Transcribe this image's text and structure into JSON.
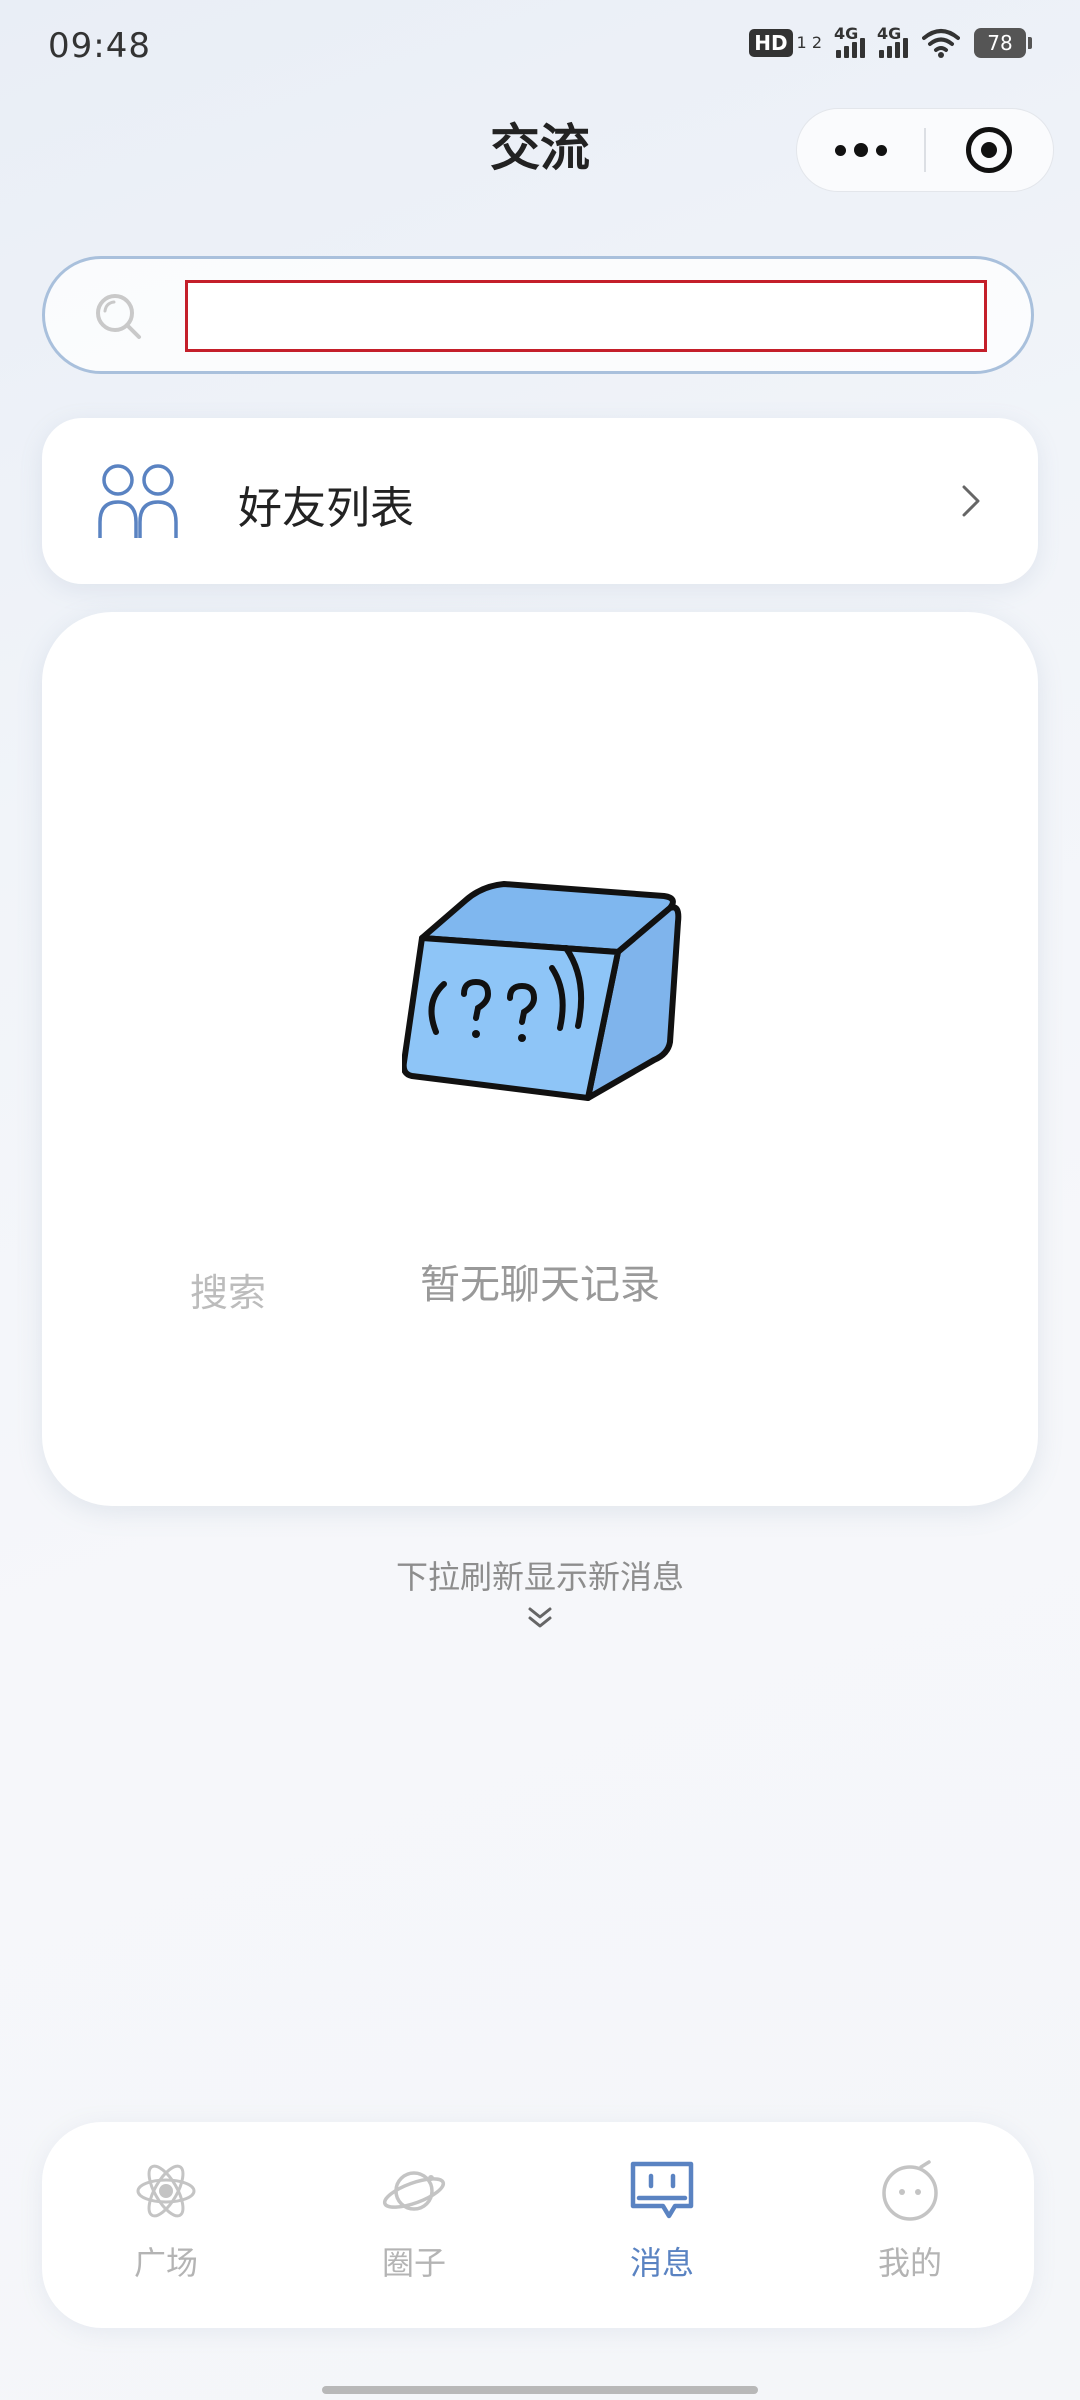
{
  "status_bar": {
    "time": "09:48",
    "hd_badge": "HD",
    "hd_sub": "1 2",
    "signal_1": "4G",
    "signal_2": "4G",
    "battery": "78"
  },
  "header": {
    "title": "交流",
    "more_icon": "more-dots-icon",
    "close_icon": "target-close-icon"
  },
  "search": {
    "value": "",
    "placeholder": "",
    "icon": "search-icon"
  },
  "friends": {
    "label": "好友列表",
    "icon": "two-people-icon"
  },
  "empty_state": {
    "side_label": "搜索",
    "message": "暂无聊天记录",
    "illustration": "confused-cube"
  },
  "pull_hint": {
    "text": "下拉刷新显示新消息"
  },
  "tabs": [
    {
      "label": "广场",
      "icon": "atom-icon",
      "active": false
    },
    {
      "label": "圈子",
      "icon": "planet-icon",
      "active": false
    },
    {
      "label": "消息",
      "icon": "message-icon",
      "active": true
    },
    {
      "label": "我的",
      "icon": "profile-face-icon",
      "active": false
    }
  ],
  "colors": {
    "accent": "#5a83c2",
    "search_border": "#a9c0dc",
    "input_border": "#c41f2a",
    "cube_fill": "#8ec5f7",
    "inactive": "#b4b4b4"
  }
}
